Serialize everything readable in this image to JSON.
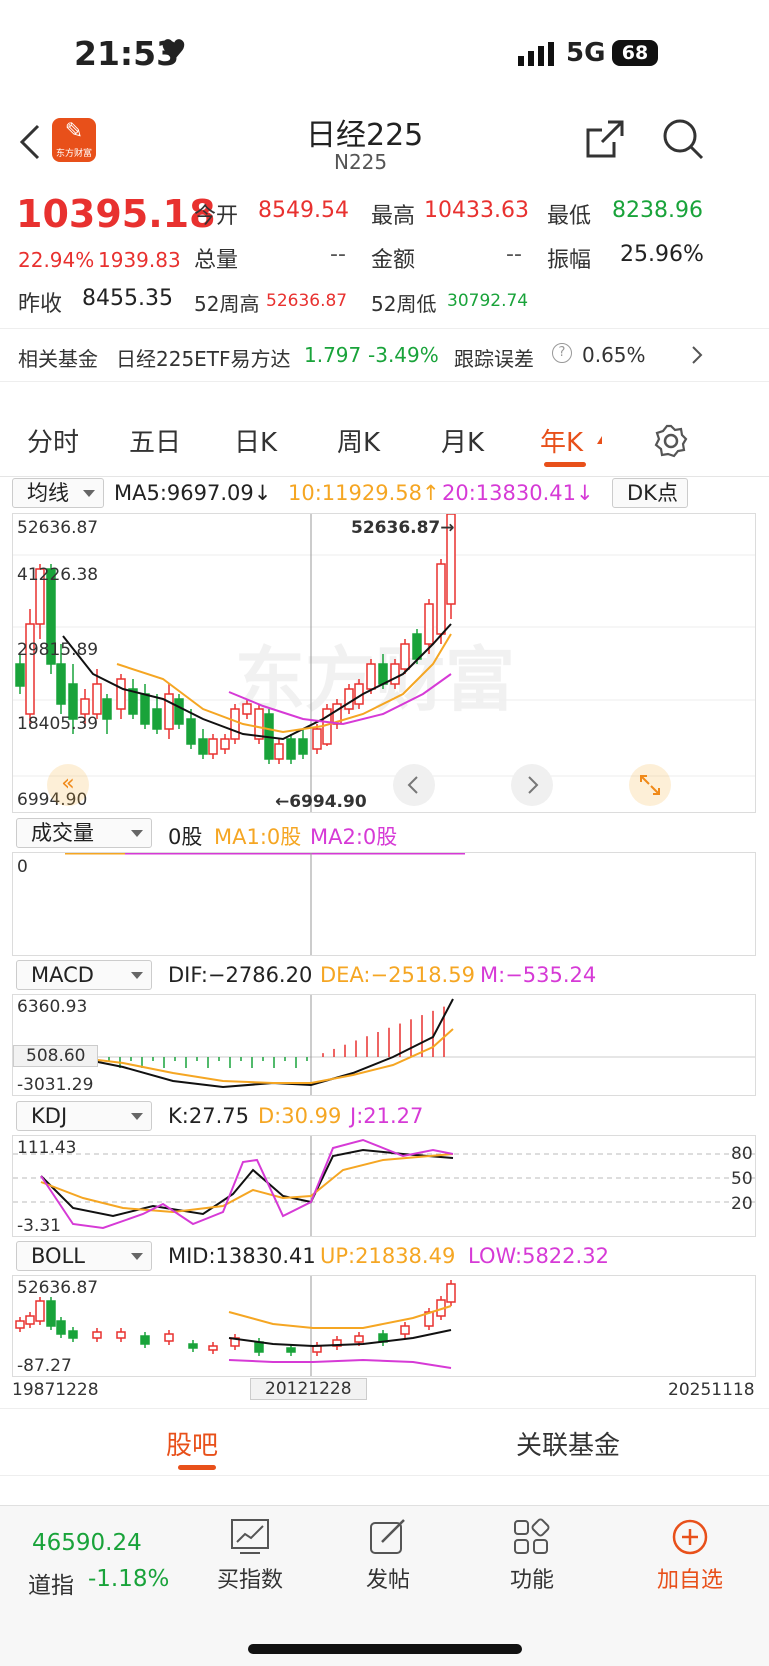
{
  "status": {
    "time": "21:53",
    "network": "5G",
    "battery": "68"
  },
  "header": {
    "title": "日经225",
    "code": "N225",
    "logo_text": "东方财富"
  },
  "quote": {
    "price": "10395.18",
    "change_pct": "22.94%",
    "change": "1939.83",
    "open_label": "今开",
    "open": "8549.54",
    "high_label": "最高",
    "high": "10433.63",
    "low_label": "最低",
    "low": "8238.96",
    "volume_label": "总量",
    "volume": "--",
    "amount_label": "金额",
    "amount": "--",
    "amplitude_label": "振幅",
    "amplitude": "25.96%",
    "prev_close_label": "昨收",
    "prev_close": "8455.35",
    "w52_high_label": "52周高",
    "w52_high": "52636.87",
    "w52_low_label": "52周低",
    "w52_low": "30792.74"
  },
  "fund": {
    "label": "相关基金",
    "name": "日经225ETF易方达",
    "price": "1.797",
    "change": "-3.49%",
    "tracking_label": "跟踪误差",
    "tracking": "0.65%"
  },
  "tabs": [
    "分时",
    "五日",
    "日K",
    "周K",
    "月K",
    "年K"
  ],
  "active_tab": "年K",
  "ma": {
    "selector": "均线",
    "ma5": "MA5:9697.09↓",
    "ma10": "10:11929.58↑",
    "ma20": "20:13830.41↓",
    "dk": "DK点"
  },
  "kline_axis": {
    "labels": [
      "52636.87",
      "41226.38",
      "29815.89",
      "18405.39",
      "6994.90"
    ],
    "max_marker": "52636.87→",
    "min_marker": "←6994.90"
  },
  "volume": {
    "selector": "成交量",
    "value": "0股",
    "ma1": "MA1:0股",
    "ma2": "MA2:0股",
    "axis": "0"
  },
  "macd": {
    "selector": "MACD",
    "dif": "DIF:−2786.20",
    "dea": "DEA:−2518.59",
    "m": "M:−535.24",
    "axis_top": "6360.93",
    "axis_mid": "508.60",
    "axis_bottom": "-3031.29"
  },
  "kdj": {
    "selector": "KDJ",
    "k": "K:27.75",
    "d": "D:30.99",
    "j": "J:21.27",
    "axis_top": "111.43",
    "axis_bottom": "-3.31",
    "levels": [
      "80",
      "50",
      "20"
    ]
  },
  "boll": {
    "selector": "BOLL",
    "mid": "MID:13830.41",
    "up": "UP:21838.49",
    "low": "LOW:5822.32",
    "axis_top": "52636.87",
    "axis_bottom": "-87.27"
  },
  "dates": {
    "start": "19871228",
    "cursor": "20121228",
    "end": "20251118"
  },
  "bottom_tabs": {
    "left": "股吧",
    "right": "关联基金"
  },
  "bottom_nav": {
    "index_value": "46590.24",
    "index_name": "道指",
    "index_change": "-1.18%",
    "items": [
      "买指数",
      "发帖",
      "功能",
      "加自选"
    ]
  },
  "colors": {
    "up": "#e8312f",
    "down": "#19a33a",
    "accent": "#e8501a",
    "ma10": "#f5a623",
    "ma20": "#d63ad6"
  }
}
